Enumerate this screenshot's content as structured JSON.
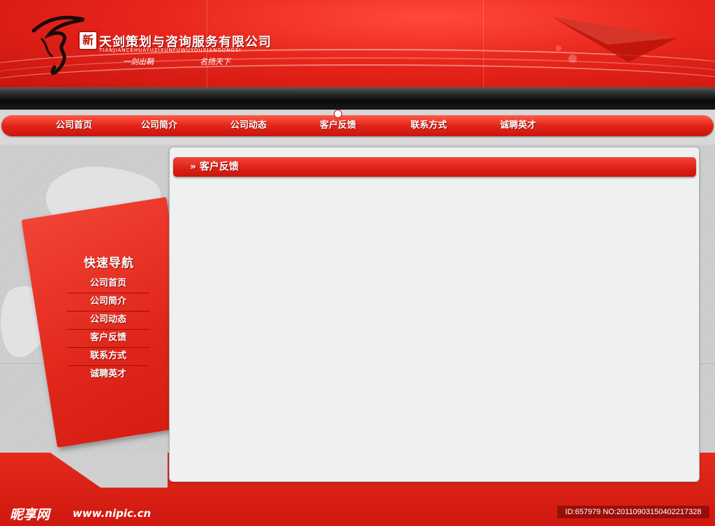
{
  "header": {
    "logo_badge": "新",
    "company_name": "天剑策划与咨询服务有限公司",
    "company_pinyin": "TIANJIANCEHUAYUZIXUNFUWUYOUXIANGONGSI",
    "slogan_left": "一剑出鞘",
    "slogan_right": "名扬天下"
  },
  "nav": {
    "items": [
      {
        "label": "公司首页"
      },
      {
        "label": "公司简介"
      },
      {
        "label": "公司动态"
      },
      {
        "label": "客户反馈"
      },
      {
        "label": "联系方式"
      },
      {
        "label": "诚聘英才"
      }
    ],
    "active_index": 3
  },
  "sidebar": {
    "title": "快速导航",
    "items": [
      {
        "label": "公司首页"
      },
      {
        "label": "公司简介"
      },
      {
        "label": "公司动态"
      },
      {
        "label": "客户反馈"
      },
      {
        "label": "联系方式"
      },
      {
        "label": "诚聘英才"
      }
    ]
  },
  "main": {
    "title": "» 客户反馈"
  },
  "footer": {
    "watermark_logo": "昵享网",
    "watermark_url": "www.nipic.cn",
    "image_id": "ID:657979 NO:20110903150402217328"
  },
  "colors": {
    "brand_red": "#e0261a",
    "dark_bar": "#1a1a1a",
    "panel_bg": "#eff1f0"
  }
}
